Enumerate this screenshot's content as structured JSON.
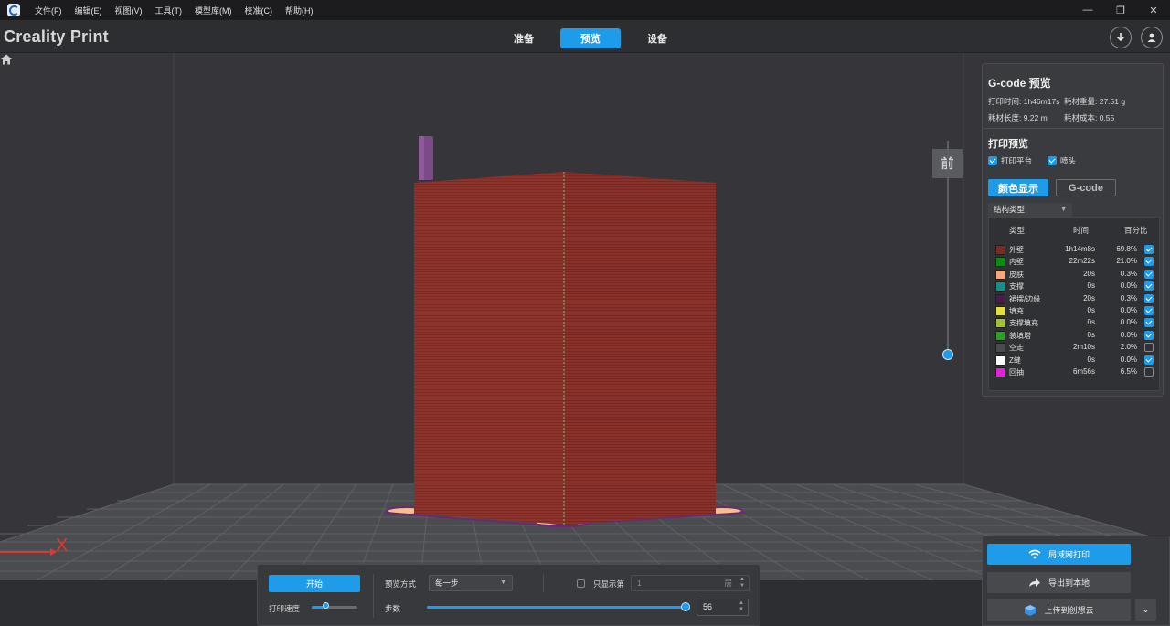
{
  "window": {
    "menu": [
      "文件(F)",
      "编辑(E)",
      "视图(V)",
      "工具(T)",
      "模型库(M)",
      "校准(C)",
      "帮助(H)"
    ],
    "minimize_glyph": "—",
    "maximize_glyph": "❐",
    "close_glyph": "✕"
  },
  "header": {
    "brand": "Creality Print",
    "tabs": [
      {
        "label": "准备",
        "active": false
      },
      {
        "label": "预览",
        "active": true
      },
      {
        "label": "设备",
        "active": false
      }
    ],
    "download_icon": "download-icon",
    "user_icon": "user-icon"
  },
  "viewport": {
    "view_front_label": "前",
    "axis_x_label": "X",
    "layer_slider_fraction": 1.0
  },
  "gcode_panel": {
    "title": "G-code 预览",
    "print_time": "打印时间: 1h46m17s",
    "filament_weight": "耗材重量: 27.51 g",
    "filament_length": "耗材长度: 9.22 m",
    "filament_cost": "耗材成本: 0.55",
    "print_preview_title": "打印预览",
    "checkbox_platform": "打印平台",
    "checkbox_nozzle": "喷头",
    "color_display_button": "颜色显示",
    "gcode_button": "G-code",
    "structure_select": "结构类型",
    "legend_headers": {
      "type": "类型",
      "time": "时间",
      "percent": "百分比"
    },
    "legend": [
      {
        "name": "外壁",
        "time": "1h14m8s",
        "percent": "69.8%",
        "color": "#7b2a26",
        "checked": true
      },
      {
        "name": "内壁",
        "time": "22m22s",
        "percent": "21.0%",
        "color": "#0d8a12",
        "checked": true
      },
      {
        "name": "皮肤",
        "time": "20s",
        "percent": "0.3%",
        "color": "#f5a67c",
        "checked": true
      },
      {
        "name": "支撑",
        "time": "0s",
        "percent": "0.0%",
        "color": "#12908a",
        "checked": true
      },
      {
        "name": "裙摆/边缘",
        "time": "20s",
        "percent": "0.3%",
        "color": "#4a1a4e",
        "checked": true
      },
      {
        "name": "填充",
        "time": "0s",
        "percent": "0.0%",
        "color": "#e6df3a",
        "checked": true
      },
      {
        "name": "支撑填充",
        "time": "0s",
        "percent": "0.0%",
        "color": "#a3c12b",
        "checked": true
      },
      {
        "name": "装填塔",
        "time": "0s",
        "percent": "0.0%",
        "color": "#2aa11f",
        "checked": true
      },
      {
        "name": "空走",
        "time": "2m10s",
        "percent": "2.0%",
        "color": "#4a4b4f",
        "checked": false
      },
      {
        "name": "Z缝",
        "time": "0s",
        "percent": "0.0%",
        "color": "#ffffff",
        "checked": true
      },
      {
        "name": "回抽",
        "time": "6m56s",
        "percent": "6.5%",
        "color": "#e51ee0",
        "checked": false
      }
    ]
  },
  "controls": {
    "start_button": "开始",
    "print_speed_label": "打印速度",
    "print_speed_fraction": 0.3,
    "preview_mode_label": "预览方式",
    "preview_mode_value": "每一步",
    "only_show_label": "只显示第",
    "only_show_checked": false,
    "layer_value": "1",
    "layer_unit": "层",
    "steps_label": "步数",
    "steps_value": "56",
    "steps_fraction": 1.0
  },
  "export": {
    "lan_print": "局域网打印",
    "export_local": "导出到本地",
    "upload_cloud": "上传到创想云",
    "more_glyph": "⌄"
  },
  "colors": {
    "accent": "#1e9be9",
    "model_wall": "#8e332c",
    "bed_grid": "#5f6064"
  }
}
